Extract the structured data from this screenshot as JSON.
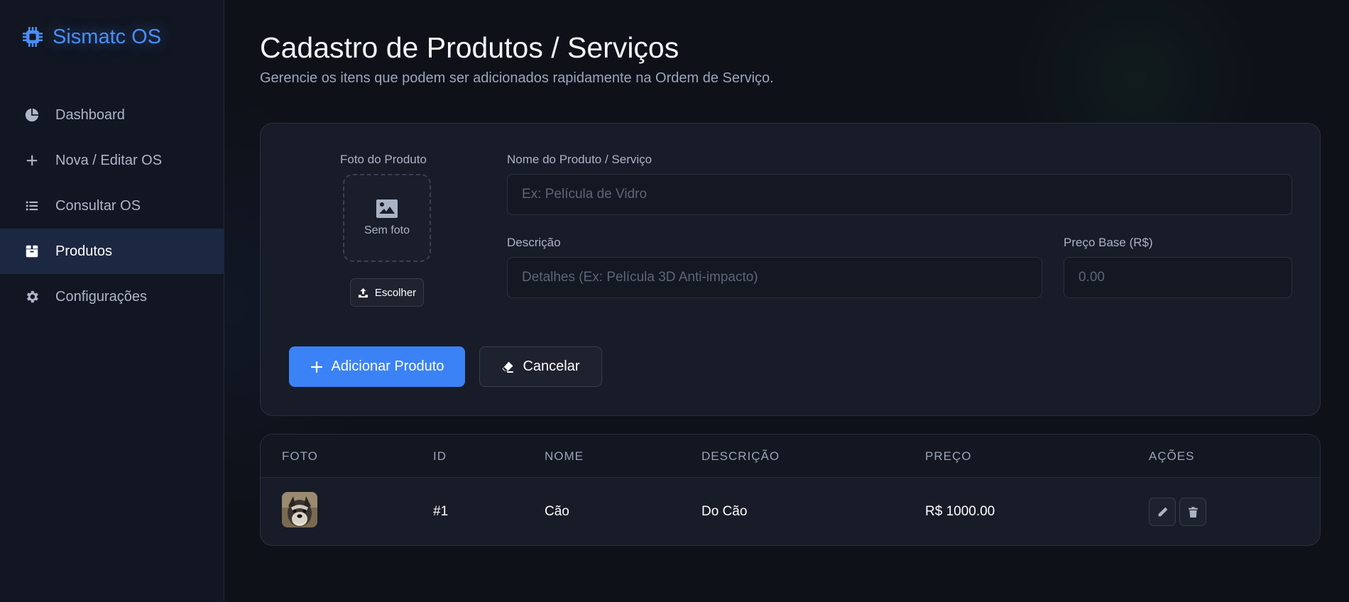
{
  "sidebar": {
    "brand": "Sismatc OS",
    "items": [
      {
        "label": "Dashboard",
        "icon": "pie-chart-icon"
      },
      {
        "label": "Nova / Editar OS",
        "icon": "plus-icon"
      },
      {
        "label": "Consultar OS",
        "icon": "list-icon"
      },
      {
        "label": "Produtos",
        "icon": "box-icon",
        "active": true
      },
      {
        "label": "Configurações",
        "icon": "gear-icon"
      }
    ]
  },
  "page": {
    "title": "Cadastro de Produtos / Serviços",
    "subtitle": "Gerencie os itens que podem ser adicionados rapidamente na Ordem de Serviço."
  },
  "form": {
    "photo_label": "Foto do Produto",
    "photo_placeholder": "Sem foto",
    "choose_label": "Escolher",
    "name_label": "Nome do Produto / Serviço",
    "name_placeholder": "Ex: Película de Vidro",
    "description_label": "Descrição",
    "description_placeholder": "Detalhes (Ex: Película 3D Anti-impacto)",
    "price_label": "Preço Base (R$)",
    "price_placeholder": "0.00",
    "add_label": "Adicionar Produto",
    "cancel_label": "Cancelar"
  },
  "table": {
    "headers": {
      "photo": "FOTO",
      "id": "ID",
      "name": "NOME",
      "description": "DESCRIÇÃO",
      "price": "PREÇO",
      "actions": "AÇÕES"
    },
    "rows": [
      {
        "id": "#1",
        "name": "Cão",
        "description": "Do Cão",
        "price": "R$ 1000.00"
      }
    ]
  },
  "colors": {
    "accent": "#3b82f6",
    "background": "#0e1118",
    "sidebar": "#121622",
    "card": "#181c28"
  }
}
